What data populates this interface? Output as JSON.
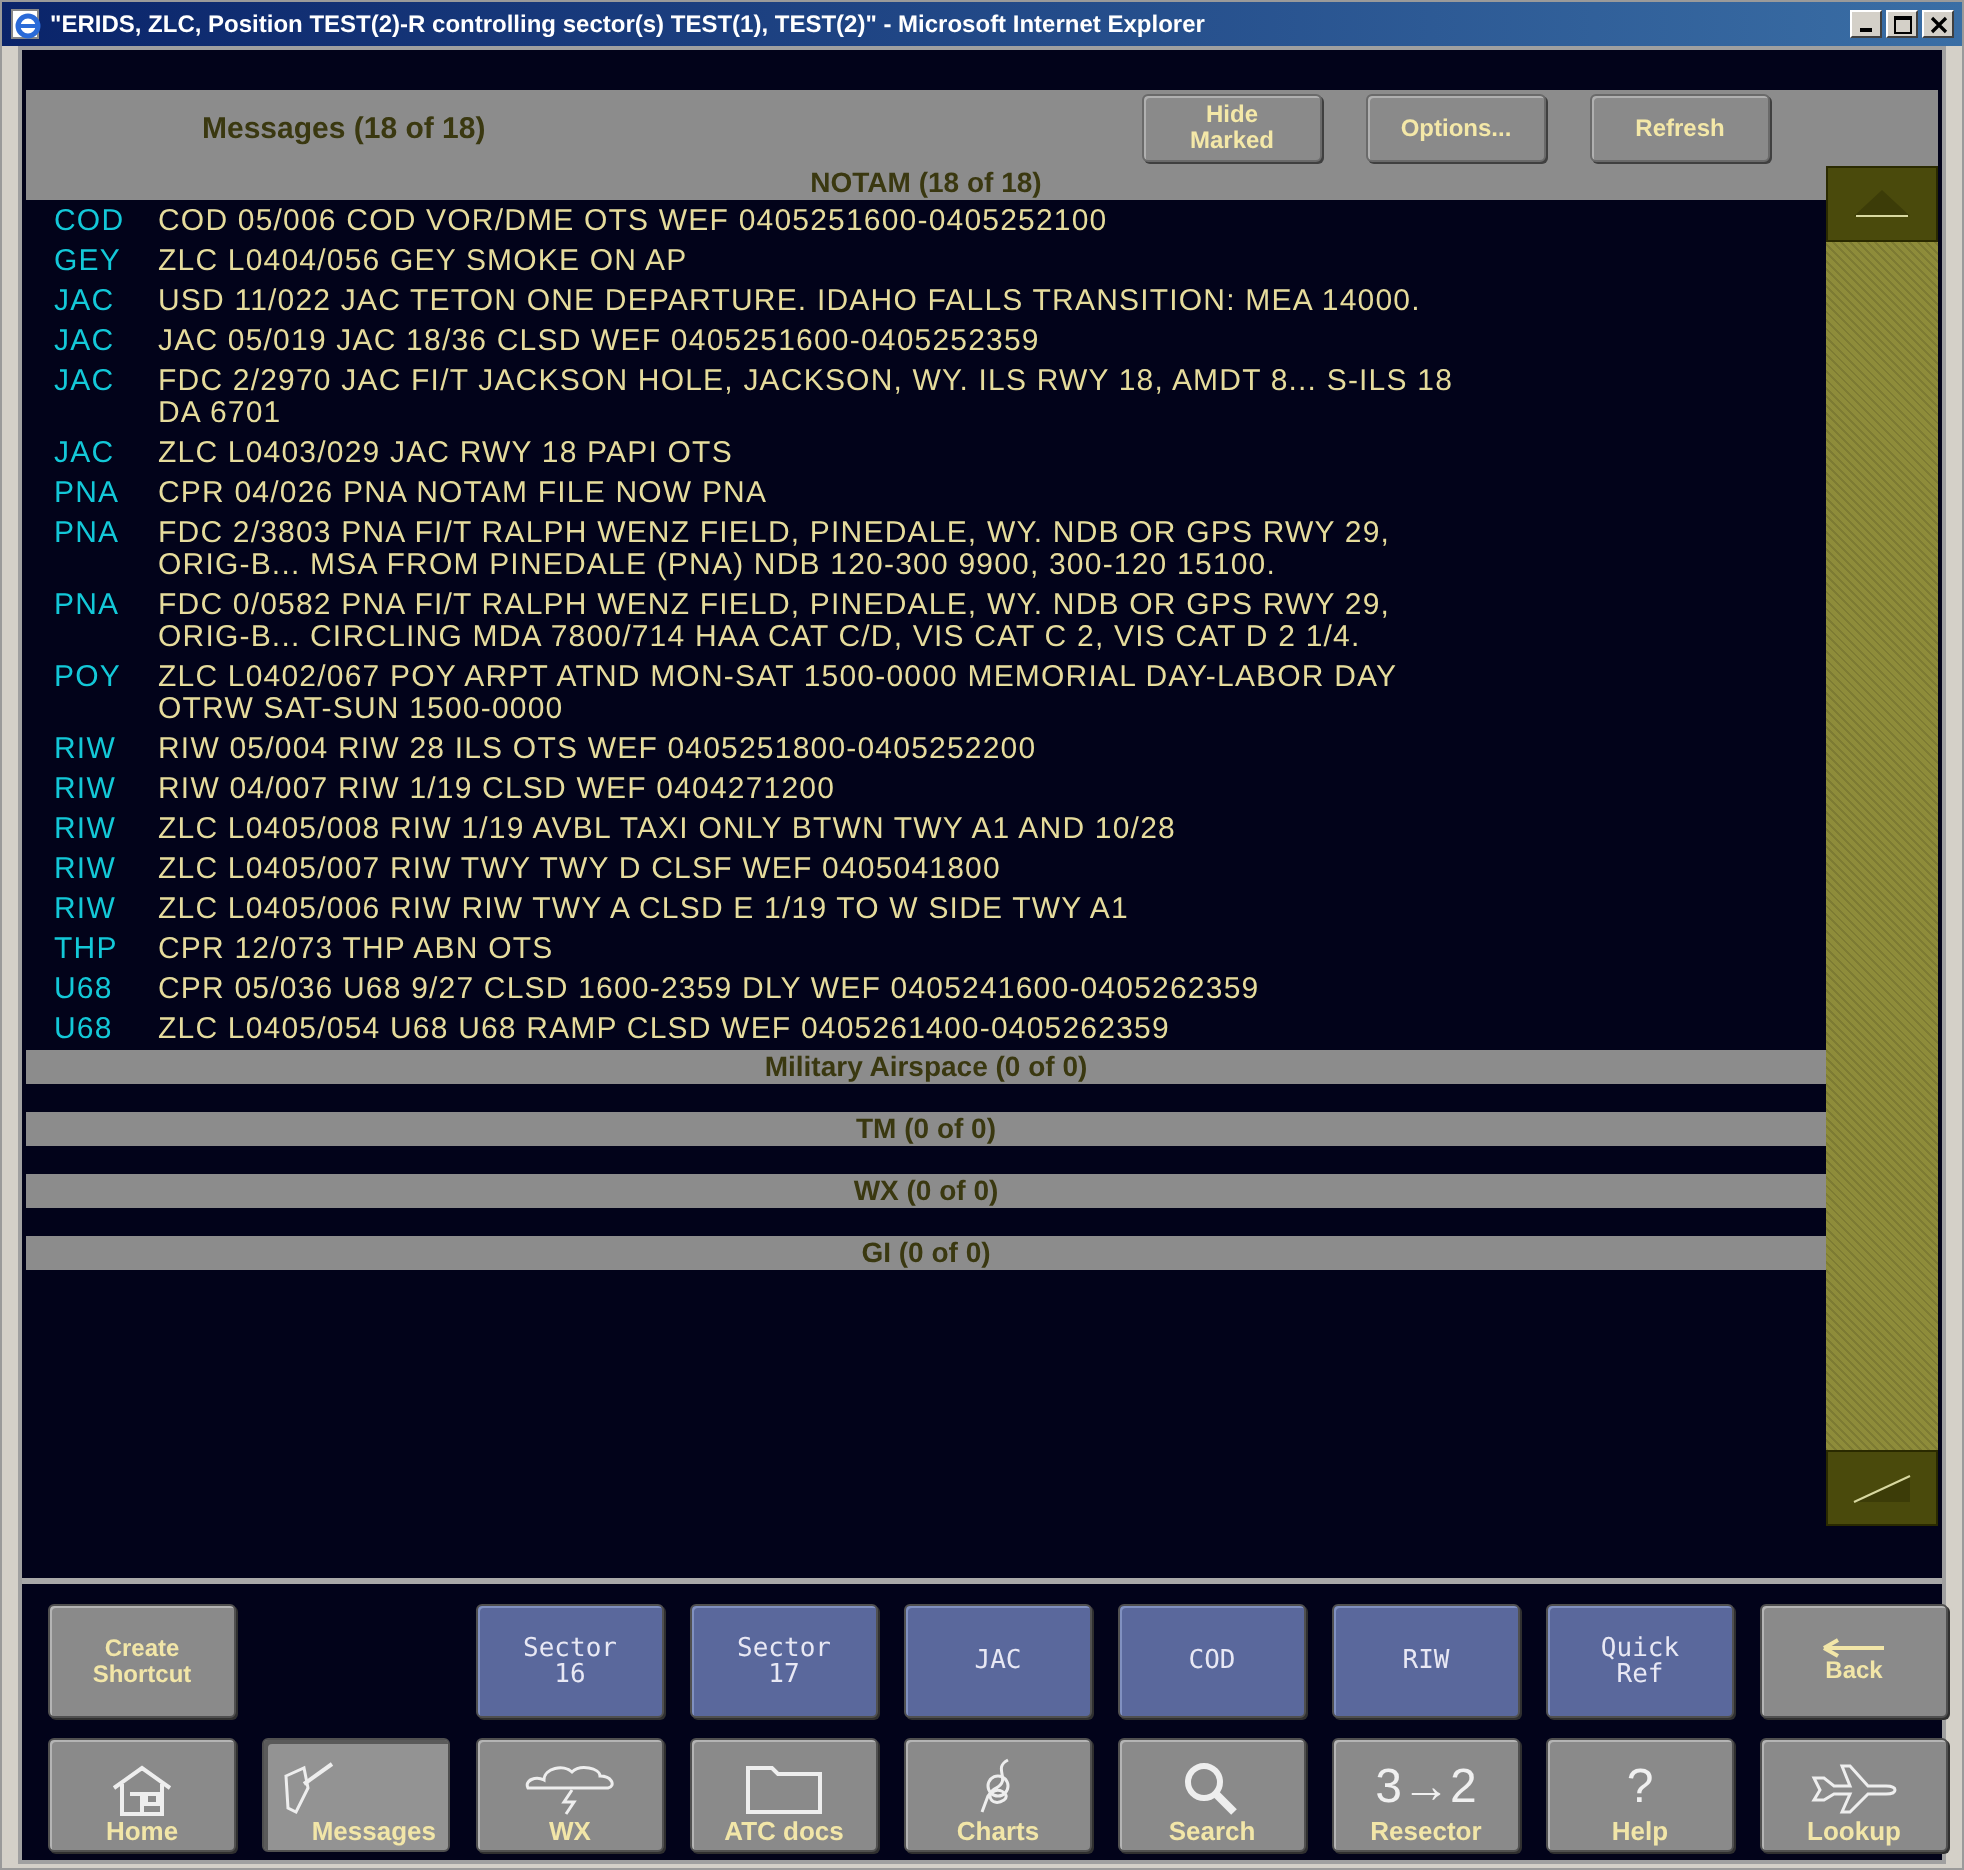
{
  "window": {
    "title": "\"ERIDS, ZLC, Position TEST(2)-R controlling sector(s) TEST(1), TEST(2)\" - Microsoft Internet Explorer"
  },
  "header": {
    "title": "Messages (18 of 18)",
    "buttons": [
      {
        "lines": [
          "Hide",
          "Marked"
        ]
      },
      {
        "lines": [
          "Options..."
        ]
      },
      {
        "lines": [
          "Refresh"
        ]
      }
    ]
  },
  "sections": [
    {
      "title": "NOTAM (18 of 18)",
      "messages": [
        {
          "code": "COD",
          "lines": [
            "COD 05/006 COD VOR/DME OTS WEF 0405251600-0405252100"
          ]
        },
        {
          "code": "GEY",
          "lines": [
            "ZLC L0404/056 GEY SMOKE ON AP"
          ]
        },
        {
          "code": "JAC",
          "lines": [
            "USD 11/022 JAC TETON ONE DEPARTURE. IDAHO FALLS TRANSITION: MEA 14000."
          ]
        },
        {
          "code": "JAC",
          "lines": [
            "JAC 05/019 JAC 18/36 CLSD WEF 0405251600-0405252359"
          ]
        },
        {
          "code": "JAC",
          "lines": [
            "FDC 2/2970 JAC FI/T JACKSON HOLE, JACKSON, WY. ILS RWY 18, AMDT 8... S-ILS 18",
            "DA 6701"
          ]
        },
        {
          "code": "JAC",
          "lines": [
            "ZLC L0403/029 JAC RWY 18 PAPI OTS"
          ]
        },
        {
          "code": "PNA",
          "lines": [
            "CPR 04/026 PNA NOTAM FILE NOW PNA"
          ]
        },
        {
          "code": "PNA",
          "lines": [
            "FDC 2/3803 PNA FI/T RALPH WENZ FIELD, PINEDALE, WY. NDB OR GPS RWY 29,",
            "ORIG-B... MSA FROM PINEDALE (PNA) NDB 120-300 9900, 300-120 15100."
          ]
        },
        {
          "code": "PNA",
          "lines": [
            "FDC 0/0582 PNA FI/T RALPH WENZ FIELD, PINEDALE, WY. NDB OR GPS RWY 29,",
            "ORIG-B... CIRCLING MDA 7800/714 HAA CAT C/D, VIS CAT C 2, VIS CAT D 2 1/4."
          ]
        },
        {
          "code": "POY",
          "lines": [
            "ZLC L0402/067 POY ARPT ATND MON-SAT 1500-0000 MEMORIAL DAY-LABOR DAY",
            "OTRW SAT-SUN 1500-0000"
          ]
        },
        {
          "code": "RIW",
          "lines": [
            "RIW 05/004 RIW 28 ILS OTS WEF 0405251800-0405252200"
          ]
        },
        {
          "code": "RIW",
          "lines": [
            "RIW 04/007 RIW 1/19 CLSD WEF 0404271200"
          ]
        },
        {
          "code": "RIW",
          "lines": [
            "ZLC L0405/008 RIW 1/19 AVBL TAXI ONLY BTWN TWY A1 AND 10/28"
          ]
        },
        {
          "code": "RIW",
          "lines": [
            "ZLC L0405/007 RIW TWY TWY D CLSF WEF 0405041800"
          ]
        },
        {
          "code": "RIW",
          "lines": [
            "ZLC L0405/006 RIW RIW TWY A CLSD E 1/19 TO W SIDE TWY A1"
          ]
        },
        {
          "code": "THP",
          "lines": [
            "CPR 12/073 THP ABN OTS"
          ]
        },
        {
          "code": "U68",
          "lines": [
            "CPR 05/036 U68 9/27 CLSD 1600-2359 DLY WEF 0405241600-0405262359"
          ]
        },
        {
          "code": "U68",
          "lines": [
            "ZLC L0405/054 U68 U68 RAMP CLSD WEF 0405261400-0405262359"
          ]
        }
      ]
    },
    {
      "title": "Military Airspace (0 of 0)"
    },
    {
      "title": "TM (0 of 0)"
    },
    {
      "title": "WX (0 of 0)"
    },
    {
      "title": "GI (0 of 0)"
    }
  ],
  "shortcut_row": [
    {
      "kind": "action",
      "lines": [
        "Create",
        "Shortcut"
      ]
    },
    {
      "kind": "shortcut",
      "lines": [
        "Sector",
        "16"
      ]
    },
    {
      "kind": "shortcut",
      "lines": [
        "Sector",
        "17"
      ]
    },
    {
      "kind": "shortcut",
      "lines": [
        "JAC"
      ]
    },
    {
      "kind": "shortcut",
      "lines": [
        "COD"
      ]
    },
    {
      "kind": "shortcut",
      "lines": [
        "RIW"
      ]
    },
    {
      "kind": "shortcut",
      "lines": [
        "Quick",
        "Ref"
      ]
    },
    {
      "kind": "back",
      "lines": [
        "Back"
      ]
    }
  ],
  "nav_row": [
    {
      "label": "Home",
      "selected": false
    },
    {
      "label": "Messages",
      "selected": true
    },
    {
      "label": "WX",
      "selected": false
    },
    {
      "label": "ATC docs",
      "selected": false
    },
    {
      "label": "Charts",
      "selected": false
    },
    {
      "label": "Search",
      "selected": false
    },
    {
      "label": "Resector",
      "selected": false,
      "glyph": "3→2"
    },
    {
      "label": "Help",
      "selected": false,
      "glyph": "?"
    },
    {
      "label": "Lookup",
      "selected": false
    }
  ]
}
